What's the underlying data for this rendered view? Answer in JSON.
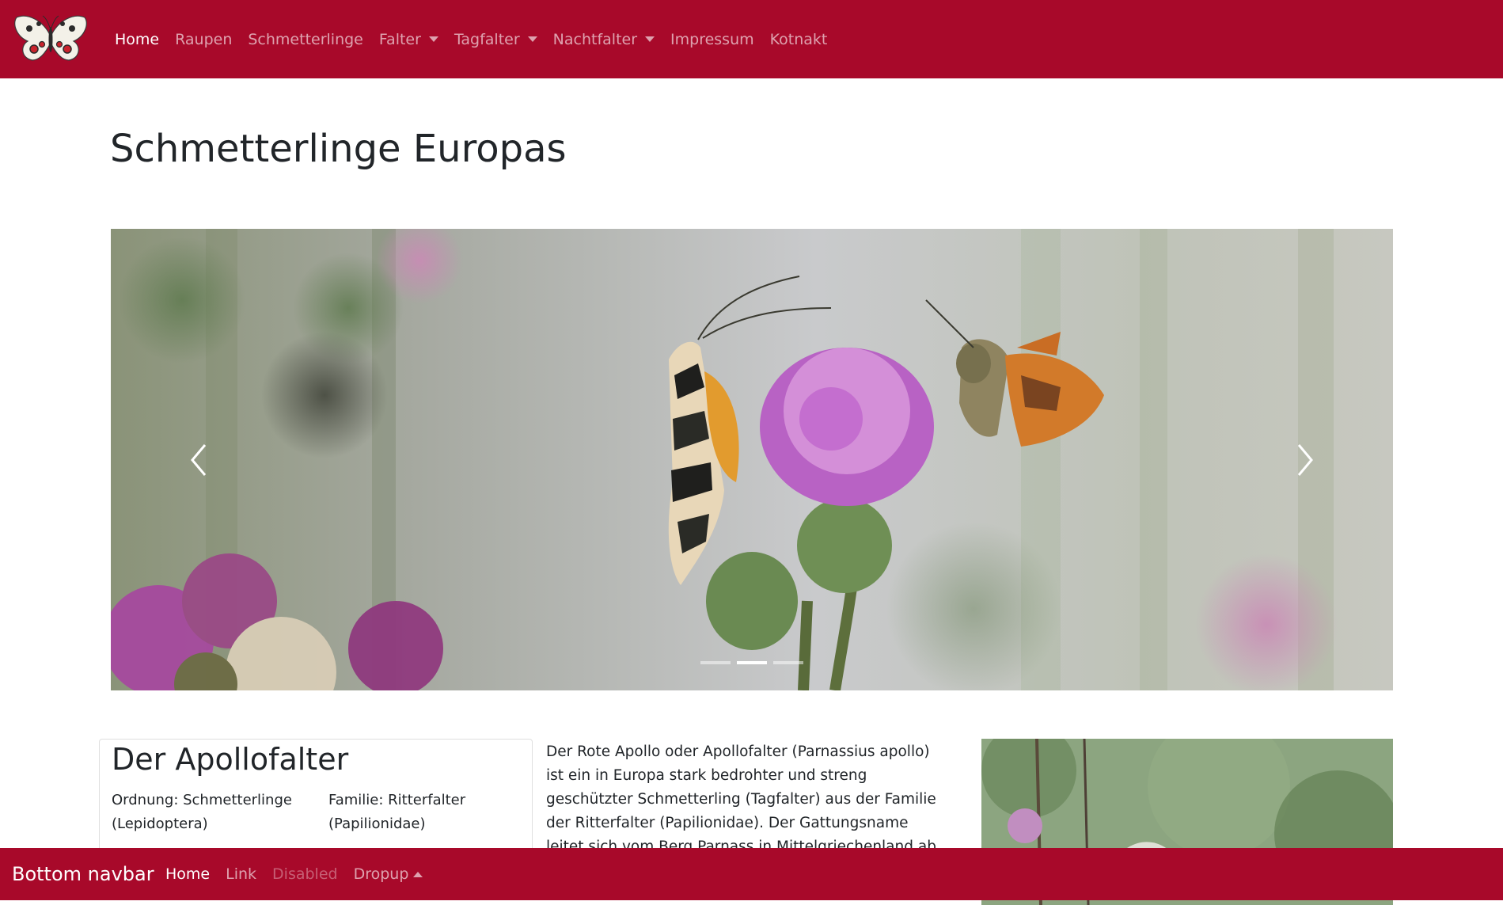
{
  "topnav": {
    "logo_name": "butterfly-logo",
    "items": [
      {
        "label": "Home"
      },
      {
        "label": "Raupen"
      },
      {
        "label": "Schmetterlinge"
      },
      {
        "label": "Falter"
      },
      {
        "label": "Tagfalter"
      },
      {
        "label": "Nachtfalter"
      },
      {
        "label": "Impressum"
      },
      {
        "label": "Kotnakt"
      }
    ]
  },
  "page": {
    "title": "Schmetterlinge Europas"
  },
  "carousel": {
    "slide_count": 3,
    "active_index": 1
  },
  "article": {
    "title": "Der Apollofalter",
    "order": "Ordnung: Schmetterlinge (Lepidoptera)",
    "family": "Familie: Ritterfalter (Papilionidae)",
    "description": "Der Rote Apollo oder Apollofalter (Parnassius apollo) ist ein in Europa stark bedrohter und streng geschützter Schmetterling (Tagfalter) aus der Familie der Ritterfalter (Papilionidae). Der Gattungsname leitet sich vom Berg Parnass in Mittelgriechenland ab, der als Sitz der Musen"
  },
  "bottomnav": {
    "brand": "Bottom navbar",
    "items": [
      {
        "label": "Home"
      },
      {
        "label": "Link"
      },
      {
        "label": "Disabled"
      },
      {
        "label": "Dropup"
      }
    ]
  },
  "colors": {
    "navbar": "#a8092a",
    "background": "#ffffff"
  }
}
